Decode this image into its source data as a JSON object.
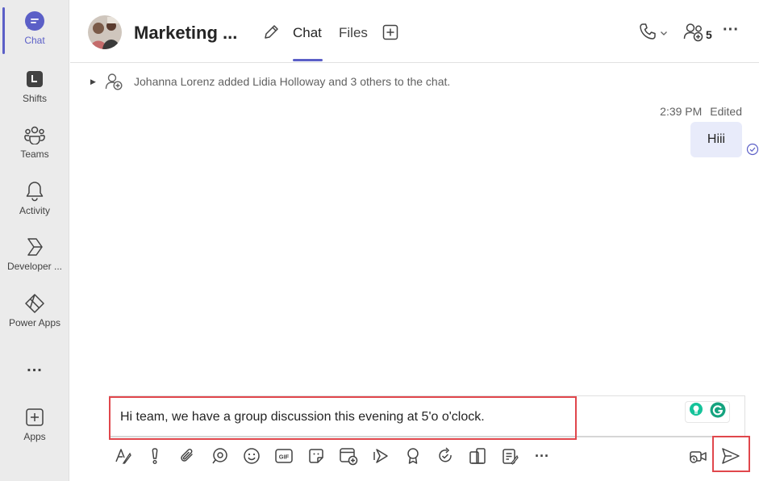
{
  "rail": {
    "items": [
      {
        "label": "Chat",
        "icon": "chat-icon"
      },
      {
        "label": "Shifts",
        "icon": "shifts-icon"
      },
      {
        "label": "Teams",
        "icon": "teams-icon"
      },
      {
        "label": "Activity",
        "icon": "bell-icon"
      },
      {
        "label": "Developer ...",
        "icon": "developer-portal-icon"
      },
      {
        "label": "Power Apps",
        "icon": "power-apps-icon"
      },
      {
        "label": "...",
        "icon": "more-icon"
      },
      {
        "label": "Apps",
        "icon": "apps-add-icon"
      }
    ],
    "accent": "#5b5fc7"
  },
  "header": {
    "title": "Marketing ...",
    "tabs": [
      {
        "label": "Chat",
        "active": true
      },
      {
        "label": "Files",
        "active": false
      }
    ],
    "participants_count": "5"
  },
  "conversation": {
    "system_message": "Johanna Lorenz added Lidia Holloway and 3 others to the chat.",
    "message": {
      "time": "2:39 PM",
      "status": "Edited",
      "text": "Hiii"
    }
  },
  "compose": {
    "text": "Hi team, we have a group discussion this evening at 5'o o'clock.",
    "highlight_color": "#e0474c"
  },
  "toolbar": {
    "icons": [
      "format-icon",
      "important-icon",
      "attach-icon",
      "loop-icon",
      "emoji-icon",
      "gif-icon",
      "sticker-icon",
      "schedule-meeting-icon",
      "stream-icon",
      "praise-icon",
      "update-icon",
      "apps-icon",
      "forms-icon",
      "more-options-icon"
    ],
    "right_icons": [
      "video-clip-icon",
      "send-icon"
    ]
  }
}
